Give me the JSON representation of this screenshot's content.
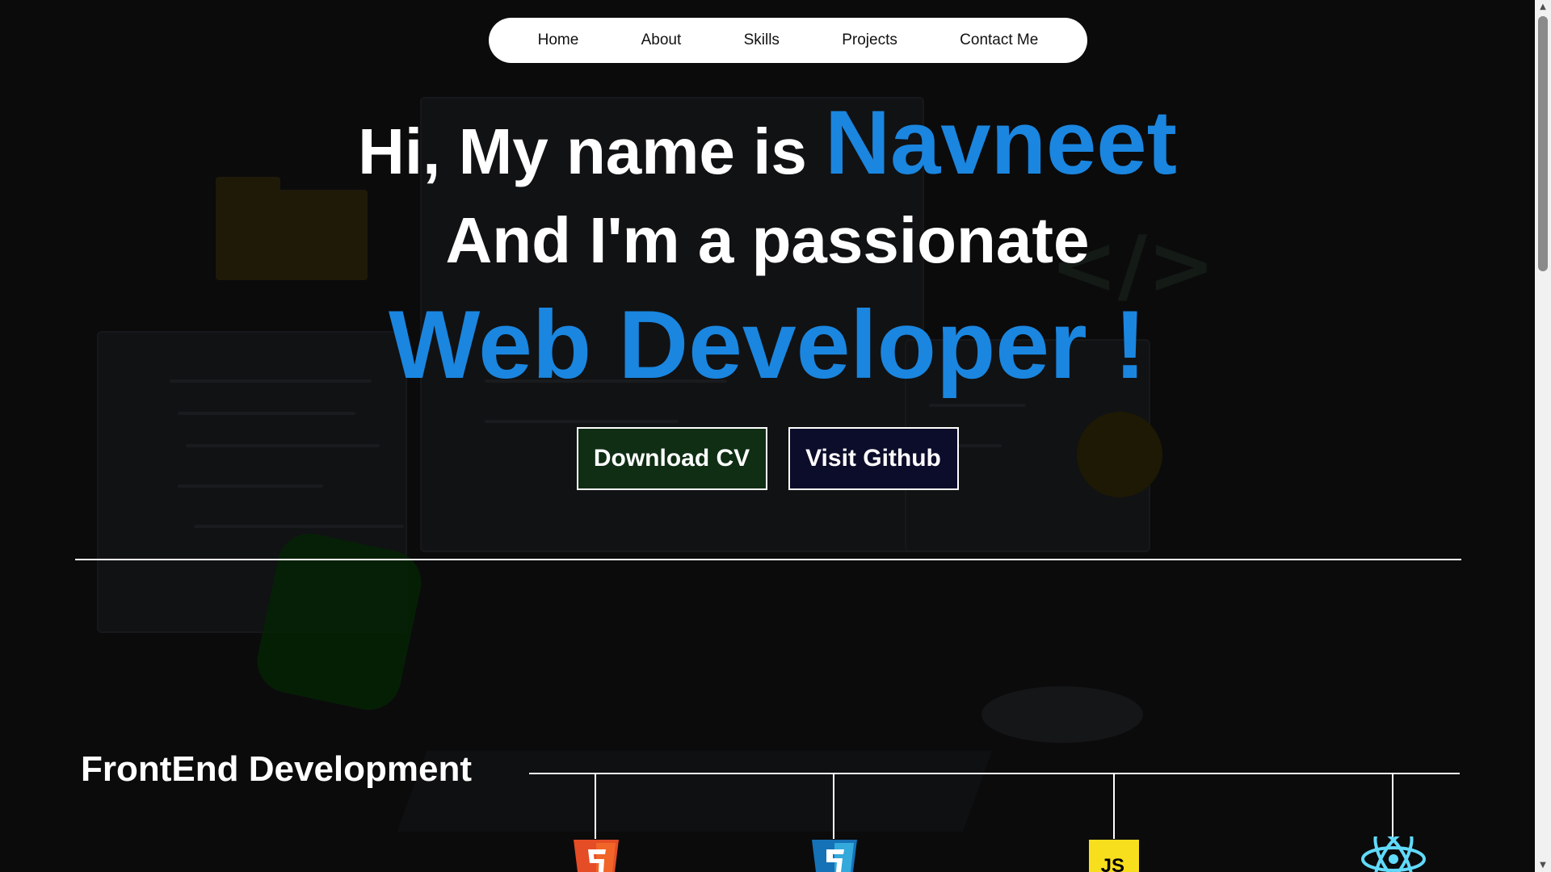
{
  "nav": {
    "items": [
      {
        "label": "Home"
      },
      {
        "label": "About"
      },
      {
        "label": "Skills"
      },
      {
        "label": "Projects"
      },
      {
        "label": "Contact Me"
      }
    ]
  },
  "hero": {
    "line1_prefix": "Hi, My name is",
    "name": "Navneet",
    "line2": "And I'm a passionate",
    "line3": "Web Developer !",
    "accent_color": "#1a86e0"
  },
  "buttons": {
    "cv": "Download CV",
    "github": "Visit Github"
  },
  "skills": {
    "frontend_title": "FrontEnd Development",
    "icons": [
      "html5-icon",
      "css3-icon",
      "javascript-icon",
      "react-icon"
    ]
  },
  "icons": {
    "js_label": "JS"
  }
}
